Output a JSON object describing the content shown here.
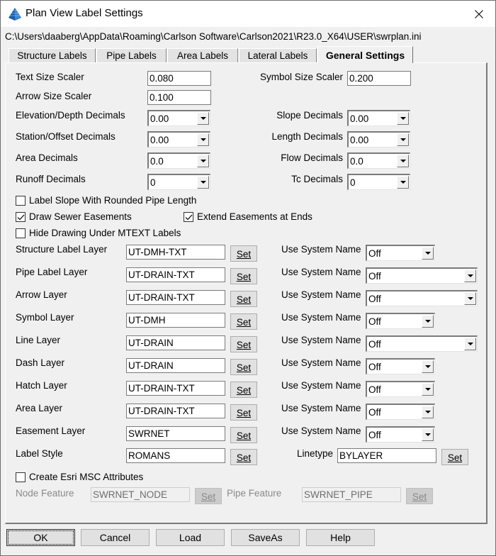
{
  "window": {
    "title": "Plan View Label Settings",
    "app_icon": "carlson-pyramid-icon",
    "close_icon": "close-icon"
  },
  "path": "C:\\Users\\daaberg\\AppData\\Roaming\\Carlson Software\\Carlson2021\\R23.0_X64\\USER\\swrplan.ini",
  "tabs": [
    {
      "label": "Structure Labels",
      "active": false
    },
    {
      "label": "Pipe Labels",
      "active": false
    },
    {
      "label": "Area Labels",
      "active": false
    },
    {
      "label": "Lateral Labels",
      "active": false
    },
    {
      "label": "General Settings",
      "active": true
    }
  ],
  "scalers": {
    "text_size": {
      "label": "Text Size Scaler",
      "value": "0.080"
    },
    "arrow_size": {
      "label": "Arrow Size Scaler",
      "value": "0.100"
    },
    "symbol_size": {
      "label": "Symbol Size Scaler",
      "value": "0.200"
    }
  },
  "decimals": {
    "elevation_depth": {
      "label": "Elevation/Depth Decimals",
      "value": "0.00"
    },
    "station_offset": {
      "label": "Station/Offset Decimals",
      "value": "0.00"
    },
    "area": {
      "label": "Area Decimals",
      "value": "0.0"
    },
    "runoff": {
      "label": "Runoff Decimals",
      "value": "0"
    },
    "slope": {
      "label": "Slope Decimals",
      "value": "0.00"
    },
    "length": {
      "label": "Length Decimals",
      "value": "0.00"
    },
    "flow": {
      "label": "Flow Decimals",
      "value": "0.0"
    },
    "tc": {
      "label": "Tc Decimals",
      "value": "0"
    }
  },
  "checkboxes": {
    "label_slope": {
      "label": "Label Slope With Rounded Pipe Length",
      "checked": false
    },
    "draw_easements": {
      "label": "Draw Sewer Easements",
      "checked": true
    },
    "extend_easements": {
      "label": "Extend Easements at Ends",
      "checked": true
    },
    "hide_drawing": {
      "label": "Hide Drawing Under MTEXT Labels",
      "checked": false
    },
    "create_esri": {
      "label": "Create Esri MSC Attributes",
      "checked": false
    }
  },
  "layers": [
    {
      "label": "Structure Label Layer",
      "value": "UT-DMH-TXT",
      "set": "Set",
      "sys_label": "Use System Name",
      "sys_value": "Off"
    },
    {
      "label": "Pipe Label Layer",
      "value": "UT-DRAIN-TXT",
      "set": "Set",
      "sys_label": "Use System Name",
      "sys_value": "Off"
    },
    {
      "label": "Arrow Layer",
      "value": "UT-DRAIN-TXT",
      "set": "Set",
      "sys_label": "Use System Name",
      "sys_value": "Off"
    },
    {
      "label": "Symbol Layer",
      "value": "UT-DMH",
      "set": "Set",
      "sys_label": "Use System Name",
      "sys_value": "Off"
    },
    {
      "label": "Line Layer",
      "value": "UT-DRAIN",
      "set": "Set",
      "sys_label": "Use System Name",
      "sys_value": "Off"
    },
    {
      "label": "Dash Layer",
      "value": "UT-DRAIN",
      "set": "Set",
      "sys_label": "Use System Name",
      "sys_value": "Off"
    },
    {
      "label": "Hatch Layer",
      "value": "UT-DRAIN-TXT",
      "set": "Set",
      "sys_label": "Use System Name",
      "sys_value": "Off"
    },
    {
      "label": "Area Layer",
      "value": "UT-DRAIN-TXT",
      "set": "Set",
      "sys_label": "Use System Name",
      "sys_value": "Off"
    },
    {
      "label": "Easement Layer",
      "value": "SWRNET",
      "set": "Set",
      "sys_label": "Use System Name",
      "sys_value": "Off"
    }
  ],
  "label_style": {
    "label": "Label Style",
    "value": "ROMANS",
    "set": "Set"
  },
  "linetype": {
    "label": "Linetype",
    "value": "BYLAYER",
    "set": "Set"
  },
  "esri": {
    "node_feature": {
      "label": "Node Feature",
      "value": "SWRNET_NODE",
      "set": "Set",
      "disabled": true
    },
    "pipe_feature": {
      "label": "Pipe Feature",
      "value": "SWRNET_PIPE",
      "set": "Set",
      "disabled": true
    }
  },
  "buttons": {
    "ok": "OK",
    "cancel": "Cancel",
    "load": "Load",
    "saveas": "SaveAs",
    "help": "Help"
  }
}
